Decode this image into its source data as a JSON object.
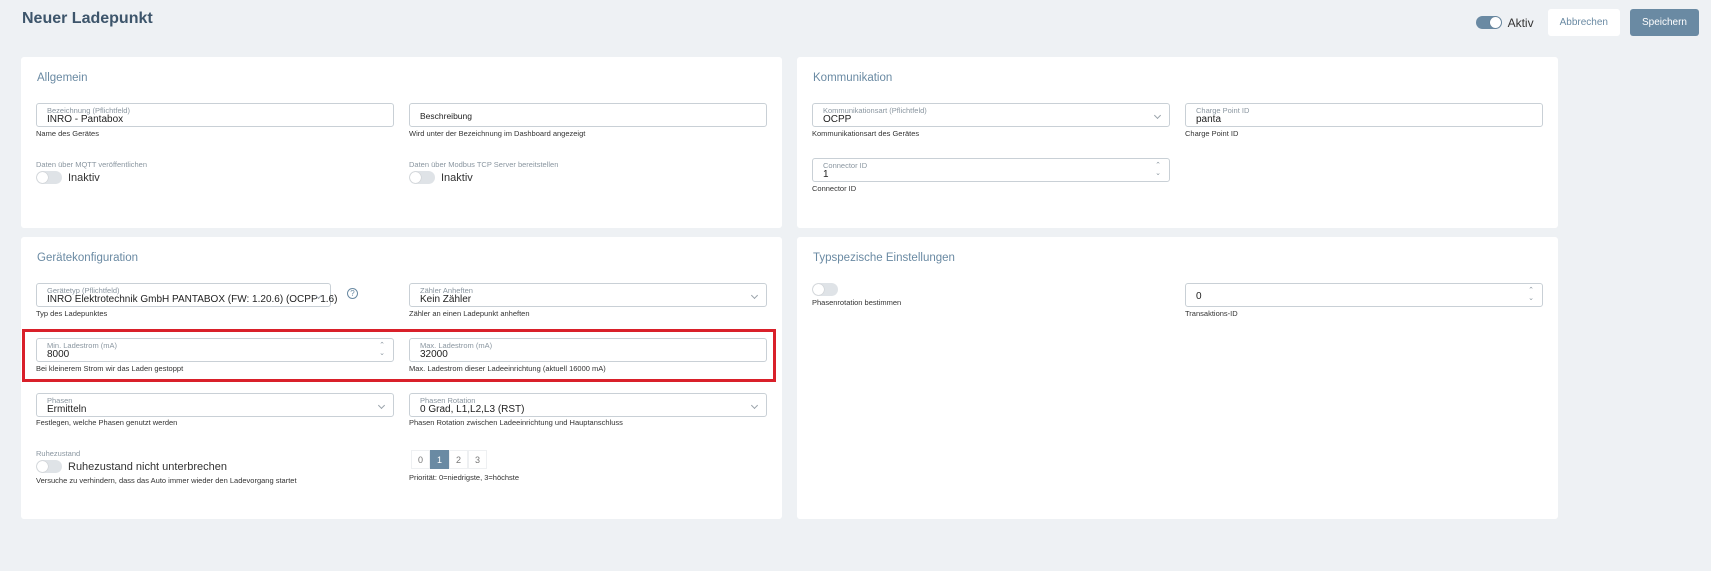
{
  "page": {
    "title": "Neuer Ladepunkt"
  },
  "header": {
    "active_label": "Aktiv",
    "cancel_label": "Abbrechen",
    "save_label": "Speichern"
  },
  "allgemein": {
    "title": "Allgemein",
    "name": {
      "label": "Bezeichnung (Pflichtfeld)",
      "value": "INRO - Pantabox",
      "hint": "Name des Gerätes"
    },
    "description": {
      "placeholder": "Beschreibung",
      "hint": "Wird unter der Bezeichnung im Dashboard angezeigt"
    },
    "mqtt": {
      "label": "Daten über MQTT veröffentlichen",
      "state": "Inaktiv"
    },
    "modbus": {
      "label": "Daten über Modbus TCP Server bereitstellen",
      "state": "Inaktiv"
    }
  },
  "kommunikation": {
    "title": "Kommunikation",
    "type": {
      "label": "Kommunikationsart (Pflichtfeld)",
      "value": "OCPP",
      "hint": "Kommunikationsart des Gerätes"
    },
    "cpid": {
      "label": "Charge Point ID",
      "value": "panta",
      "hint": "Charge Point ID"
    },
    "connector": {
      "label": "Connector ID",
      "value": "1",
      "hint": "Connector ID"
    }
  },
  "geraet": {
    "title": "Gerätekonfiguration",
    "type": {
      "label": "Gerätetyp (Pflichtfeld)",
      "value": "INRO Elektrotechnik GmbH PANTABOX (FW: 1.20.6) (OCPP 1.6)",
      "hint": "Typ des Ladepunktes"
    },
    "meter": {
      "label": "Zähler Anheften",
      "value": "Kein Zähler",
      "hint": "Zähler an einen Ladepunkt anheften"
    },
    "min": {
      "label": "Min. Ladestrom (mA)",
      "value": "8000",
      "hint": "Bei kleinerem Strom wir das Laden gestoppt"
    },
    "max": {
      "label": "Max. Ladestrom (mA)",
      "value": "32000",
      "hint": "Max. Ladestrom dieser Ladeeinrichtung (aktuell 16000 mA)"
    },
    "phases": {
      "label": "Phasen",
      "value": "Ermitteln",
      "hint": "Festlegen, welche Phasen genutzt werden"
    },
    "rotation": {
      "label": "Phasen Rotation",
      "value": "0 Grad, L1,L2,L3 (RST)",
      "hint": "Phasen Rotation zwischen Ladeeinrichtung und Hauptanschluss"
    },
    "rest": {
      "label": "Ruhezustand",
      "state": "Ruhezustand nicht unterbrechen",
      "hint": "Versuche zu verhindern, dass das Auto immer wieder den Ladevorgang startet"
    },
    "priority": {
      "options": [
        "0",
        "1",
        "2",
        "3"
      ],
      "selected": 1,
      "hint": "Priorität: 0=niedrigste, 3=höchste"
    }
  },
  "typ": {
    "title": "Typspezische Einstellungen",
    "rotation": {
      "label": "Phasenrotation bestimmen"
    },
    "tx": {
      "value": "0",
      "hint": "Transaktions-ID"
    }
  }
}
